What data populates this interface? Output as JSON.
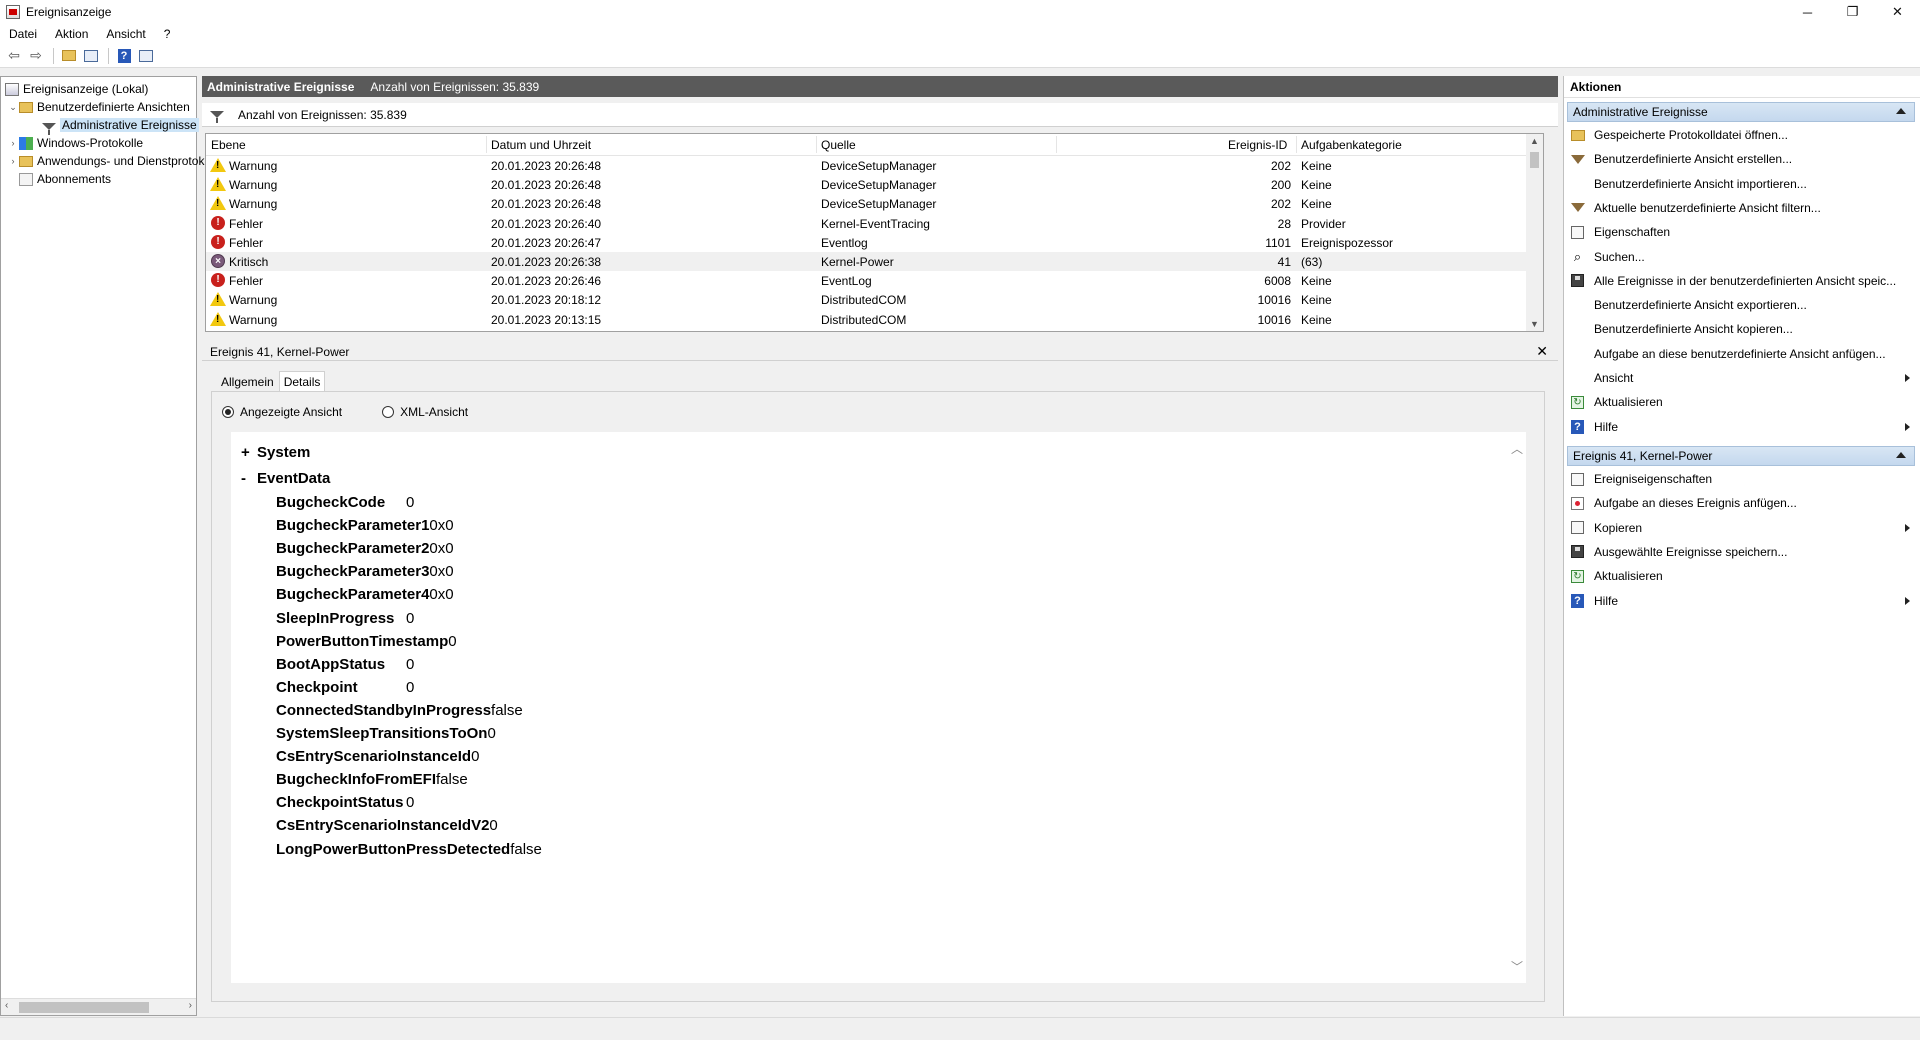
{
  "window": {
    "title": "Ereignisanzeige",
    "minimize": "─",
    "restore": "❐",
    "close": "✕"
  },
  "menu": [
    "Datei",
    "Aktion",
    "Ansicht",
    "?"
  ],
  "toolbar": {
    "icons": [
      "back-arrow-icon",
      "forward-arrow-icon",
      "open-folder-icon",
      "console-tree-icon",
      "help-icon",
      "action-pane-icon"
    ]
  },
  "tree": {
    "root": "Ereignisanzeige (Lokal)",
    "custom_views": "Benutzerdefinierte Ansichten",
    "admin_events": "Administrative Ereignisse",
    "windows_logs": "Windows-Protokolle",
    "app_logs": "Anwendungs- und Dienstprotokolle",
    "subscriptions": "Abonnements"
  },
  "header": {
    "title": "Administrative Ereignisse",
    "count": "Anzahl von Ereignissen: 35.839"
  },
  "filterbar": {
    "text": "Anzahl von Ereignissen: 35.839"
  },
  "grid": {
    "columns": {
      "level": "Ebene",
      "datetime": "Datum und Uhrzeit",
      "source": "Quelle",
      "event_id": "Ereignis-ID",
      "task": "Aufgabenkategorie"
    },
    "rows": [
      {
        "level": "Warnung",
        "type": "warn",
        "datetime": "20.01.2023 20:26:48",
        "source": "DeviceSetupManager",
        "event_id": "202",
        "task": "Keine"
      },
      {
        "level": "Warnung",
        "type": "warn",
        "datetime": "20.01.2023 20:26:48",
        "source": "DeviceSetupManager",
        "event_id": "200",
        "task": "Keine"
      },
      {
        "level": "Warnung",
        "type": "warn",
        "datetime": "20.01.2023 20:26:48",
        "source": "DeviceSetupManager",
        "event_id": "202",
        "task": "Keine"
      },
      {
        "level": "Fehler",
        "type": "err",
        "datetime": "20.01.2023 20:26:40",
        "source": "Kernel-EventTracing",
        "event_id": "28",
        "task": "Provider"
      },
      {
        "level": "Fehler",
        "type": "err",
        "datetime": "20.01.2023 20:26:47",
        "source": "Eventlog",
        "event_id": "1101",
        "task": "Ereignispozessor"
      },
      {
        "level": "Kritisch",
        "type": "crit",
        "datetime": "20.01.2023 20:26:38",
        "source": "Kernel-Power",
        "event_id": "41",
        "task": "(63)"
      },
      {
        "level": "Fehler",
        "type": "err",
        "datetime": "20.01.2023 20:26:46",
        "source": "EventLog",
        "event_id": "6008",
        "task": "Keine"
      },
      {
        "level": "Warnung",
        "type": "warn",
        "datetime": "20.01.2023 20:18:12",
        "source": "DistributedCOM",
        "event_id": "10016",
        "task": "Keine"
      },
      {
        "level": "Warnung",
        "type": "warn",
        "datetime": "20.01.2023 20:13:15",
        "source": "DistributedCOM",
        "event_id": "10016",
        "task": "Keine"
      }
    ]
  },
  "detail": {
    "title": "Ereignis 41, Kernel-Power",
    "close": "✕",
    "tabs": [
      "Allgemein",
      "Details"
    ],
    "radio_friendly": "Angezeigte Ansicht",
    "radio_xml": "XML-Ansicht",
    "system_label": "System",
    "system_toggle": "+",
    "eventdata_label": "EventData",
    "eventdata_toggle": "-",
    "fields": [
      {
        "key": "BugcheckCode",
        "value": "0"
      },
      {
        "key": "BugcheckParameter1",
        "value": "0x0"
      },
      {
        "key": "BugcheckParameter2",
        "value": "0x0"
      },
      {
        "key": "BugcheckParameter3",
        "value": "0x0"
      },
      {
        "key": "BugcheckParameter4",
        "value": "0x0"
      },
      {
        "key": "SleepInProgress",
        "value": "0"
      },
      {
        "key": "PowerButtonTimestamp",
        "value": "0"
      },
      {
        "key": "BootAppStatus",
        "value": "0"
      },
      {
        "key": "Checkpoint",
        "value": "0"
      },
      {
        "key": "ConnectedStandbyInProgress",
        "value": "false"
      },
      {
        "key": "SystemSleepTransitionsToOn",
        "value": "0"
      },
      {
        "key": "CsEntryScenarioInstanceId",
        "value": "0"
      },
      {
        "key": "BugcheckInfoFromEFI",
        "value": "false"
      },
      {
        "key": "CheckpointStatus",
        "value": "0"
      },
      {
        "key": "CsEntryScenarioInstanceIdV2",
        "value": "0"
      },
      {
        "key": "LongPowerButtonPressDetected",
        "value": "false"
      }
    ]
  },
  "actions": {
    "title": "Aktionen",
    "section1": "Administrative Ereignisse",
    "section1_items": [
      {
        "label": "Gespeicherte Protokolldatei öffnen...",
        "icon": "open"
      },
      {
        "label": "Benutzerdefinierte Ansicht erstellen...",
        "icon": "filter"
      },
      {
        "label": "Benutzerdefinierte Ansicht importieren...",
        "icon": "blank"
      },
      {
        "label": "Aktuelle benutzerdefinierte Ansicht filtern...",
        "icon": "filter"
      },
      {
        "label": "Eigenschaften",
        "icon": "prop"
      },
      {
        "label": "Suchen...",
        "icon": "find"
      },
      {
        "label": "Alle Ereignisse in der benutzerdefinierten Ansicht speic...",
        "icon": "save"
      },
      {
        "label": "Benutzerdefinierte Ansicht exportieren...",
        "icon": "blank"
      },
      {
        "label": "Benutzerdefinierte Ansicht kopieren...",
        "icon": "blank"
      },
      {
        "label": "Aufgabe an diese benutzerdefinierte Ansicht anfügen...",
        "icon": "blank"
      },
      {
        "label": "Ansicht",
        "icon": "blank",
        "submenu": true
      },
      {
        "label": "Aktualisieren",
        "icon": "refresh"
      },
      {
        "label": "Hilfe",
        "icon": "help",
        "submenu": true
      }
    ],
    "section2": "Ereignis 41, Kernel-Power",
    "section2_items": [
      {
        "label": "Ereigniseigenschaften",
        "icon": "prop"
      },
      {
        "label": "Aufgabe an dieses Ereignis anfügen...",
        "icon": "task"
      },
      {
        "label": "Kopieren",
        "icon": "prop",
        "submenu": true
      },
      {
        "label": "Ausgewählte Ereignisse speichern...",
        "icon": "save"
      },
      {
        "label": "Aktualisieren",
        "icon": "refresh"
      },
      {
        "label": "Hilfe",
        "icon": "help",
        "submenu": true
      }
    ]
  }
}
